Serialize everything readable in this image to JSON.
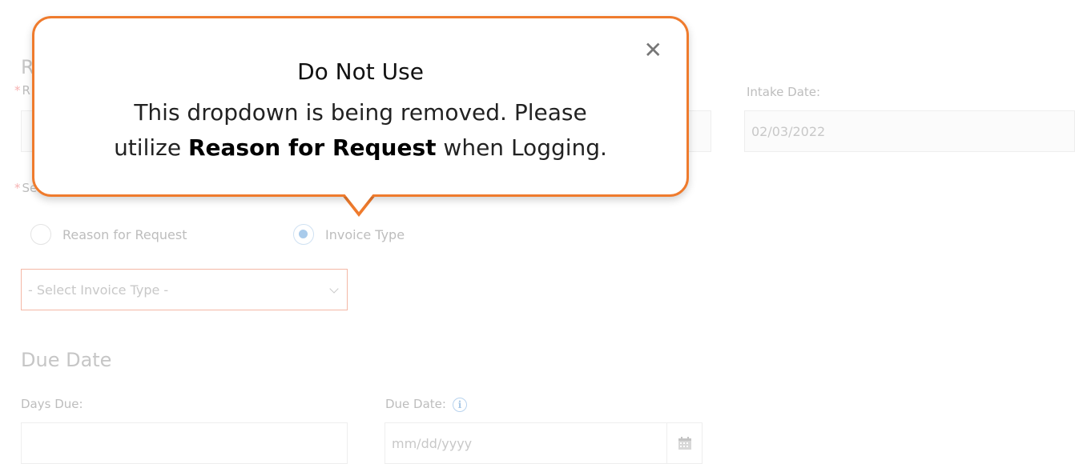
{
  "form": {
    "intake_date_label": "Intake Date:",
    "intake_date_value": "02/03/2022",
    "partial_section_letter": "R",
    "partial_field_letter": "R",
    "partial_select_letter": "Se",
    "radio_options": [
      {
        "label": "Reason for Request",
        "checked": false
      },
      {
        "label": "Invoice Type",
        "checked": true
      }
    ],
    "invoice_type_select": "- Select Invoice Type -",
    "due_date_section": "Due Date",
    "days_due_label": "Days Due:",
    "due_date_label": "Due Date:",
    "due_date_placeholder": "mm/dd/yyyy",
    "info_icon_glyph": "i"
  },
  "callout": {
    "title": "Do Not Use",
    "body_line1": "This dropdown is being removed. Please",
    "body_prefix": "utilize ",
    "body_bold": "Reason for Request",
    "body_suffix": " when Logging.",
    "close_glyph": "✕",
    "border_color": "#ef7b2d"
  }
}
